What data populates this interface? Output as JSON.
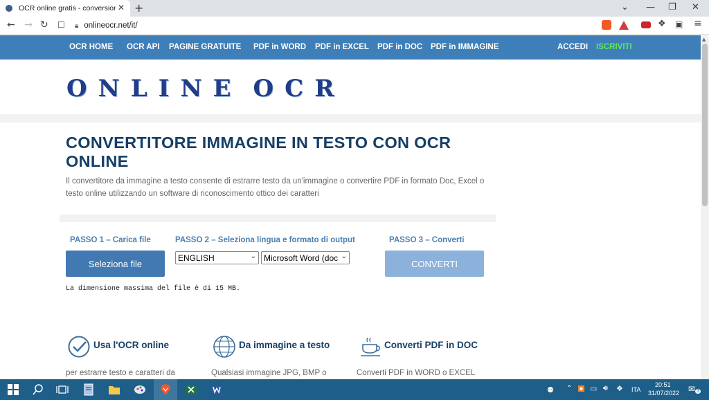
{
  "browser": {
    "tab_title": "OCR online gratis - conversione Im",
    "tab_close": "✕",
    "new_tab": "+",
    "url": "onlineocr.net/it/",
    "window": {
      "chevron": "⌄",
      "minimize": "—",
      "restore": "❐",
      "close": "✕"
    }
  },
  "site_nav": {
    "items": [
      "OCR HOME",
      "OCR API",
      "PAGINE GRATUITE",
      "PDF in WORD",
      "PDF in EXCEL",
      "PDF in DOC",
      "PDF in IMMAGINE"
    ],
    "login": "ACCEDI",
    "register": "ISCRIVITI"
  },
  "logo": {
    "letters": [
      "O",
      "N",
      "L",
      "I",
      "N",
      "E",
      "O",
      "C",
      "R"
    ]
  },
  "main": {
    "title": "CONVERTITORE IMMAGINE IN TESTO CON OCR ONLINE",
    "description": "Il convertitore da immagine a testo consente di estrarre testo da un'immagine o convertire PDF in formato Doc, Excel o testo online utilizzando un software di riconoscimento ottico dei caratteri",
    "step1": "PASSO 1 – Carica file",
    "step2": "PASSO 2 – Seleziona lingua e formato di output",
    "step3": "PASSO 3 – Converti",
    "select_file_button": "Seleziona file",
    "language_selected": "ENGLISH",
    "format_selected": "Microsoft Word (doc",
    "convert_button": "CONVERTI",
    "max_size_note": "La dimensione massima del file è di 15 MB."
  },
  "features": [
    {
      "title": "Usa l'OCR online",
      "text": "per estrarre testo e caratteri da",
      "icon": "check-circle-icon"
    },
    {
      "title": "Da immagine a testo",
      "text": "Qualsiasi immagine JPG, BMP o",
      "icon": "globe-icon"
    },
    {
      "title": "Converti PDF in DOC",
      "text": "Converti PDF in WORD o EXCEL",
      "icon": "coffee-cup-icon"
    }
  ],
  "taskbar": {
    "language": "ITA",
    "time": "20:51",
    "date": "31/07/2022",
    "notification_count": "3"
  },
  "colors": {
    "nav_bg": "#3e7fb9",
    "title": "#153f66",
    "accent_green": "#5ee85e",
    "button_primary": "#4279b3",
    "button_disabled": "#8cb2db",
    "taskbar": "#1e5f8a"
  }
}
